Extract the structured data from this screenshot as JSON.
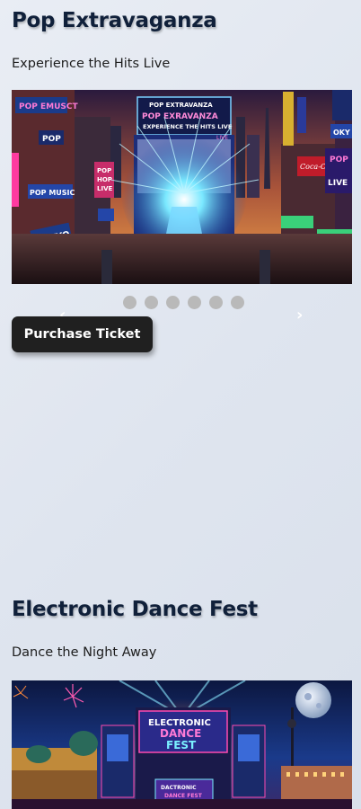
{
  "events": [
    {
      "title": "Pop Extravaganza",
      "subtitle": "Experience the Hits Live",
      "poster_text": [
        "POP EXTRAVANZA",
        "POP EXRAVANZA",
        "EXPERIENCE THE HITS LIVE"
      ],
      "poster_signs": [
        "POP EMUSCT",
        "POP",
        "POP MUSIC",
        "TOKYO",
        "POP HOP LIVE",
        "POP",
        "POP",
        "LIVE",
        "POP LIVE",
        "TOKYO",
        "OKY"
      ],
      "carousel": {
        "prev_label": "‹",
        "next_label": "›",
        "dot_count": 6,
        "active_index": 0
      },
      "purchase_label": "Purchase Ticket"
    },
    {
      "title": "Electronic Dance Fest",
      "subtitle": "Dance the Night Away",
      "poster_text": [
        "ELECTRONIC",
        "DANCE",
        "FEST",
        "DACTRONIC DANCE FEST"
      ]
    }
  ],
  "colors": {
    "title": "#10203a",
    "button_bg": "#202020",
    "dot": "#b9b9b9"
  }
}
